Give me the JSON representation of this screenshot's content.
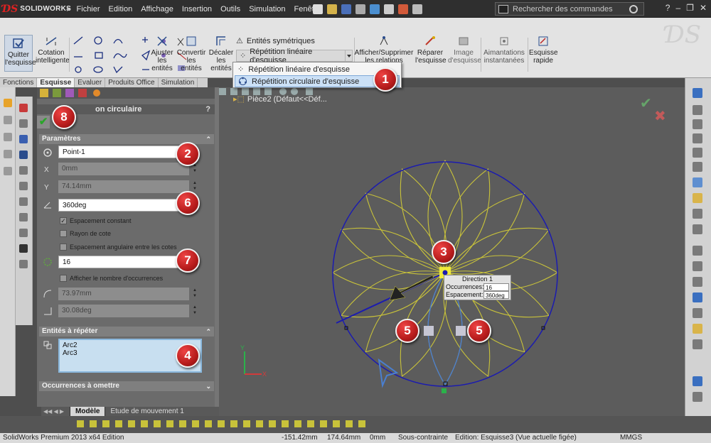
{
  "app": {
    "logo_text": "SOLIDWORKS"
  },
  "menu": [
    "Fichier",
    "Edition",
    "Affichage",
    "Insertion",
    "Outils",
    "Simulation",
    "Fenêtre",
    "?"
  ],
  "search": {
    "placeholder": "Rechercher des commandes"
  },
  "ribbon": {
    "quit_sketch": "Quitter l'esquisse",
    "smart_dimension": "Cotation intelligente",
    "trim": "Ajuster les entités",
    "convert": "Convertir les entités",
    "offset": "Décaler les entités",
    "mirror": "Entités symétriques",
    "linear_pattern": "Répétition linéaire d'esquisse",
    "show_relations": "Afficher/Supprimer les relations",
    "repair": "Réparer l'esquisse",
    "image": "Image d'esquisse",
    "snaps": "Aimantations instantanées",
    "rapid": "Esquisse rapide"
  },
  "dropdown": {
    "items": [
      "Répétition linéaire d'esquisse",
      "Répétition circulaire d'esquisse"
    ]
  },
  "tabs": [
    "Fonctions",
    "Esquisse",
    "Evaluer",
    "Produits Office",
    "Simulation"
  ],
  "property_manager": {
    "title": "on circulaire",
    "parameters_header": "Paramètres",
    "center_point": "Point-1",
    "center_x": "0mm",
    "center_y": "74.14mm",
    "angle": "360deg",
    "equal_spacing_label": "Espacement constant",
    "equal_spacing_checked": true,
    "dim_radius_label": "Rayon de cote",
    "dim_angular_label": "Espacement angulaire entre les cotes",
    "instances": "16",
    "display_instances_label": "Afficher le nombre d'occurrences",
    "radius": "73.97mm",
    "arc_angle": "30.08deg",
    "entities_header": "Entités à répéter",
    "entities": [
      "Arc2",
      "Arc3"
    ],
    "skip_header": "Occurrences à omettre"
  },
  "graphics": {
    "tree_label": "Pièce2  (Défaut<<Déf...",
    "tooltip": {
      "title": "Direction 1",
      "occurrences_label": "Occurrences:",
      "occurrences_value": "16",
      "spacing_label": "Espacement:",
      "spacing_value": "360deg"
    },
    "petal_count": 16,
    "colors": {
      "circle": "#1b1bb0",
      "petals": "#c8c23a",
      "selected": "#4a7fd0"
    }
  },
  "model_tabs": [
    "Modèle",
    "Etude de mouvement 1"
  ],
  "status": {
    "edition": "SolidWorks Premium 2013 x64 Edition",
    "x": "-151.42mm",
    "y": "174.64mm",
    "z": "0mm",
    "state": "Sous-contrainte",
    "editing": "Edition: Esquisse3 (Vue actuelle figée)",
    "units": "MMGS"
  },
  "callouts": [
    "1",
    "2",
    "3",
    "4",
    "5",
    "5",
    "6",
    "7",
    "8"
  ]
}
